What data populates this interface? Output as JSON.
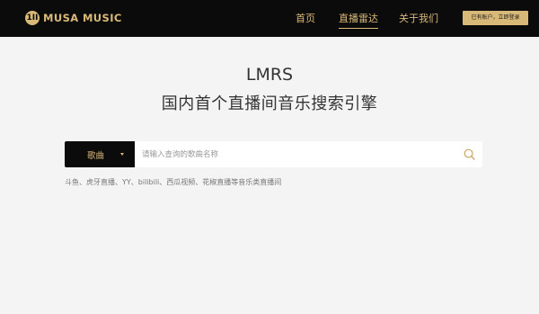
{
  "header": {
    "logo_glyph": "1II",
    "logo_text": "MUSA MUSIC",
    "nav": {
      "home": "首页",
      "radar": "直播雷达",
      "about": "关于我们"
    },
    "login_label": "已有账户，立即登录",
    "accent_color": "#d9b978",
    "background_color": "#0b0b0b"
  },
  "hero": {
    "title": "LMRS",
    "subtitle": "国内首个直播间音乐搜索引擎"
  },
  "search": {
    "type_selected": "歌曲",
    "placeholder": "请输入查询的歌曲名称",
    "value": "",
    "hint": "斗鱼、虎牙直播、YY、bilibili、西瓜视频、花椒直播等音乐类直播间"
  },
  "icons": {
    "dropdown": "caret-down-icon",
    "search": "search-icon"
  }
}
